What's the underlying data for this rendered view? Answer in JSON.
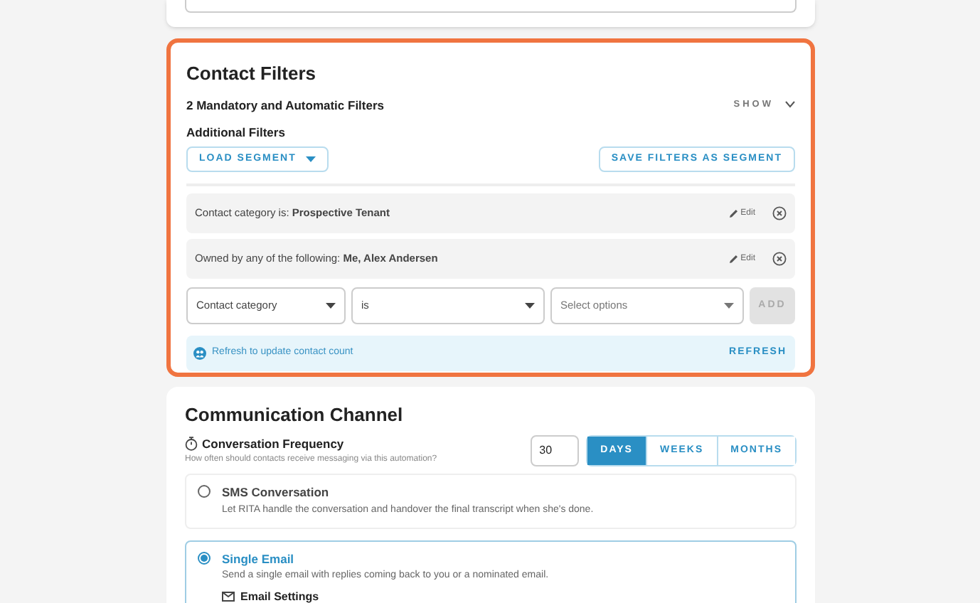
{
  "contact_filters": {
    "highlighted": true,
    "title": "Contact Filters",
    "mandatory_summary": "2 Mandatory and Automatic Filters",
    "show_toggle": {
      "label": "SHOW",
      "expanded": false
    },
    "additional_label": "Additional Filters",
    "load_segment": "LOAD SEGMENT",
    "save_segment": "SAVE FILTERS AS SEGMENT",
    "filters": [
      {
        "text": "Contact category is: **Prospective Tenant**",
        "edit": "Edit"
      },
      {
        "text": "Owned by any of the following: **Me, Alex Andersen**",
        "edit": "Edit"
      }
    ],
    "new_filter": {
      "field": "Contact category",
      "operator": "is",
      "value_placeholder": "Select options",
      "add": {
        "label": "ADD",
        "disabled": true
      }
    },
    "notice": {
      "text": "Refresh to update contact count",
      "action": "REFRESH"
    }
  },
  "communication_channel": {
    "title": "Communication Channel",
    "frequency": {
      "label": "Conversation Frequency",
      "hint": "How often should contacts receive messaging via this automation?",
      "value": "30",
      "units": [
        {
          "label": "DAYS",
          "selected": true
        },
        {
          "label": "WEEKS",
          "selected": false
        },
        {
          "label": "MONTHS",
          "selected": false
        }
      ]
    },
    "channels": [
      {
        "title": "SMS Conversation",
        "description": "Let RITA handle the conversation and handover the final transcript when she's done.",
        "selected": false
      },
      {
        "title": "Single Email",
        "description": "Send a single email with replies coming back to you or a nominated email.",
        "selected": true,
        "settings_label": "Email Settings"
      }
    ]
  }
}
